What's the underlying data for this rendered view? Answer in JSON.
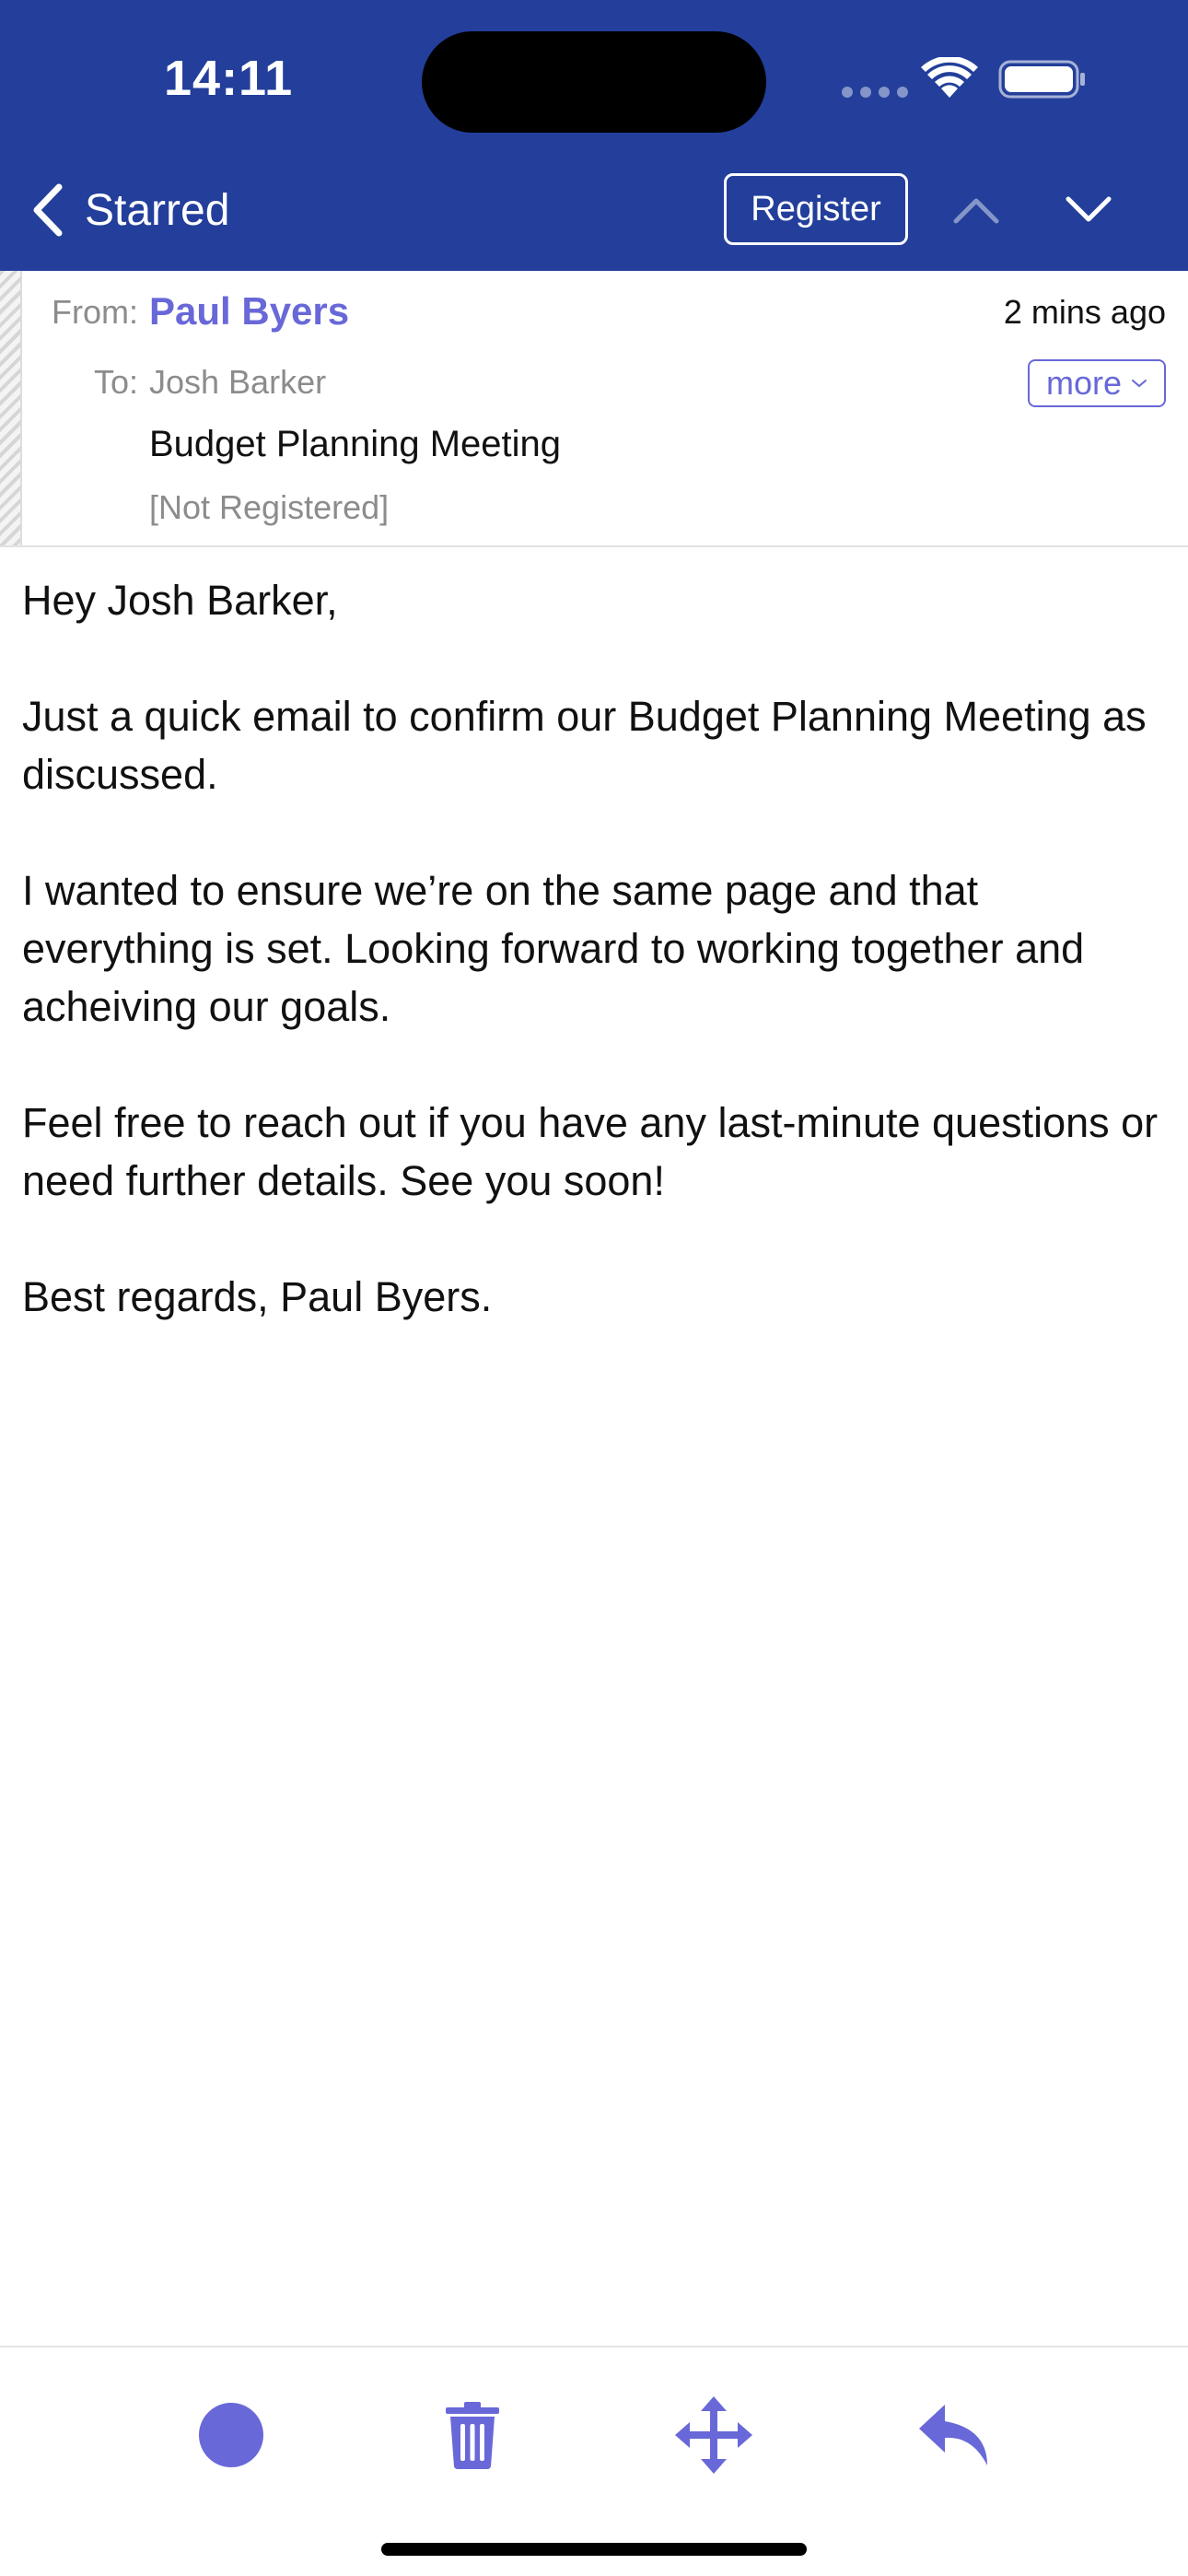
{
  "status_bar": {
    "time": "14:11"
  },
  "nav": {
    "back_label": "Starred",
    "register_label": "Register"
  },
  "message": {
    "from_label": "From:",
    "from_name": "Paul Byers",
    "timestamp": "2 mins ago",
    "to_label": "To:",
    "to_name": "Josh Barker",
    "more_label": "more",
    "subject": "Budget Planning Meeting",
    "registration_status": "[Not Registered]",
    "body": [
      "Hey Josh Barker,",
      "Just a quick email to confirm our Budget Planning Meeting as discussed.",
      "I wanted to ensure we’re on the same page and that everything is set. Looking forward to working together and acheiving our goals.",
      "Feel free to reach out if you have any last-minute questions or need further details. See you soon!",
      "Best regards, Paul Byers."
    ]
  },
  "colors": {
    "header_bg": "#233f9b",
    "accent": "#6868d8"
  },
  "toolbar": {
    "icons": [
      "unread-dot-icon",
      "trash-icon",
      "move-icon",
      "reply-icon"
    ]
  }
}
